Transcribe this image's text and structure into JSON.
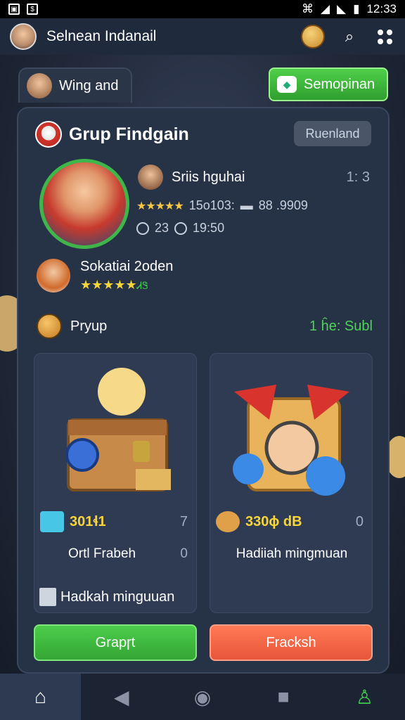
{
  "status_bar": {
    "time": "12:33"
  },
  "app_bar": {
    "title": "Selnean Indanail",
    "icons": [
      "avatar",
      "coin-icon",
      "search-icon",
      "menu-dots-icon"
    ]
  },
  "top_chip": {
    "label": "Wing and"
  },
  "top_button": {
    "label": "Semopinan"
  },
  "panel": {
    "title": "Grup Findgain",
    "badge": "Ruenland",
    "profile": {
      "name": "Sriis hguhai",
      "score": "1: 3",
      "rating_text": "15o103:",
      "stat_text": "88 .9909",
      "level": "23",
      "time": "19:50"
    },
    "member": {
      "name": "Sokatiai 2oden",
      "suffix": "ᏗᏕ"
    },
    "pryup": {
      "label": "Pryup",
      "value": "1 ĥe: Subl"
    },
    "cards": [
      {
        "amount": "301ɬ1",
        "count": "7",
        "label": "Ortl Frabeh",
        "label_value": "0",
        "footer": "Hadkah minguuan"
      },
      {
        "amount": "330ɸ dB",
        "count": "0",
        "label": "Hadiiah mingmuan"
      }
    ],
    "buttons": {
      "green": "Grapɼt",
      "red": "Fracksh"
    }
  },
  "colors": {
    "accent_green": "#3fb64a",
    "accent_red": "#e8553a",
    "panel_bg": "#263246"
  }
}
